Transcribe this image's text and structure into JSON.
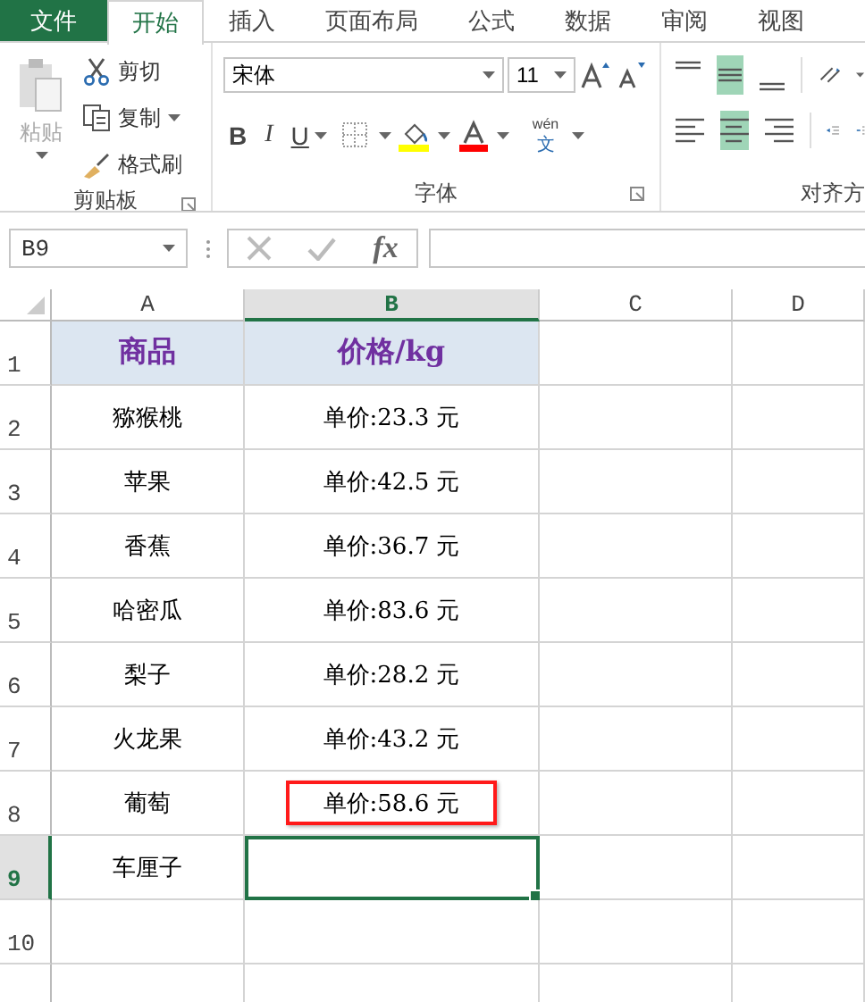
{
  "tabs": [
    {
      "label": "文件",
      "kind": "file",
      "selected": false
    },
    {
      "label": "开始",
      "kind": "tab",
      "selected": true
    },
    {
      "label": "插入",
      "kind": "tab",
      "selected": false
    },
    {
      "label": "页面布局",
      "kind": "tab",
      "selected": false
    },
    {
      "label": "公式",
      "kind": "tab",
      "selected": false
    },
    {
      "label": "数据",
      "kind": "tab",
      "selected": false
    },
    {
      "label": "审阅",
      "kind": "tab",
      "selected": false
    },
    {
      "label": "视图",
      "kind": "tab",
      "selected": false
    }
  ],
  "clipboard": {
    "paste": {
      "label": "粘贴",
      "disabled": true
    },
    "cut": "剪切",
    "copy": "复制",
    "format_painter": "格式刷",
    "label": "剪贴板"
  },
  "font": {
    "name": "宋体",
    "size": "11",
    "bold": "B",
    "italic": "I",
    "underline": "U",
    "phonetic_top": "wén",
    "phonetic_bottom": "文",
    "label": "字体"
  },
  "alignment": {
    "label": "对齐方",
    "top_row": [
      {
        "kind": "top",
        "selected": false
      },
      {
        "kind": "middle",
        "selected": true
      },
      {
        "kind": "bottom",
        "selected": false
      }
    ],
    "bottom_row": [
      {
        "kind": "left",
        "selected": false
      },
      {
        "kind": "center",
        "selected": true
      },
      {
        "kind": "right",
        "selected": false
      }
    ]
  },
  "formula_bar": {
    "name_box": "B9",
    "fx": "fx"
  },
  "columns": [
    {
      "label": "A",
      "selected": false
    },
    {
      "label": "B",
      "selected": true
    },
    {
      "label": "C",
      "selected": false
    },
    {
      "label": "D",
      "selected": false
    }
  ],
  "rows": [
    {
      "number": "1",
      "kind": "header",
      "selected": false,
      "a": "商品",
      "b": "价格/kg",
      "highlighted": false
    },
    {
      "number": "2",
      "kind": "data",
      "selected": false,
      "a": "猕猴桃",
      "b": "单价:23.3 元",
      "highlighted": false
    },
    {
      "number": "3",
      "kind": "data",
      "selected": false,
      "a": "苹果",
      "b": "单价:42.5 元",
      "highlighted": false
    },
    {
      "number": "4",
      "kind": "data",
      "selected": false,
      "a": "香蕉",
      "b": "单价:36.7 元",
      "highlighted": false
    },
    {
      "number": "5",
      "kind": "data",
      "selected": false,
      "a": "哈密瓜",
      "b": "单价:83.6 元",
      "highlighted": false
    },
    {
      "number": "6",
      "kind": "data",
      "selected": false,
      "a": "梨子",
      "b": "单价:28.2 元",
      "highlighted": false
    },
    {
      "number": "7",
      "kind": "data",
      "selected": false,
      "a": "火龙果",
      "b": "单价:43.2 元",
      "highlighted": false
    },
    {
      "number": "8",
      "kind": "data",
      "selected": false,
      "a": "葡萄",
      "b": "单价:58.6 元",
      "highlighted": true
    },
    {
      "number": "9",
      "kind": "data",
      "selected": true,
      "a": "车厘子",
      "highlighted": false
    },
    {
      "number": "10",
      "kind": "data",
      "selected": false,
      "highlighted": false
    }
  ]
}
